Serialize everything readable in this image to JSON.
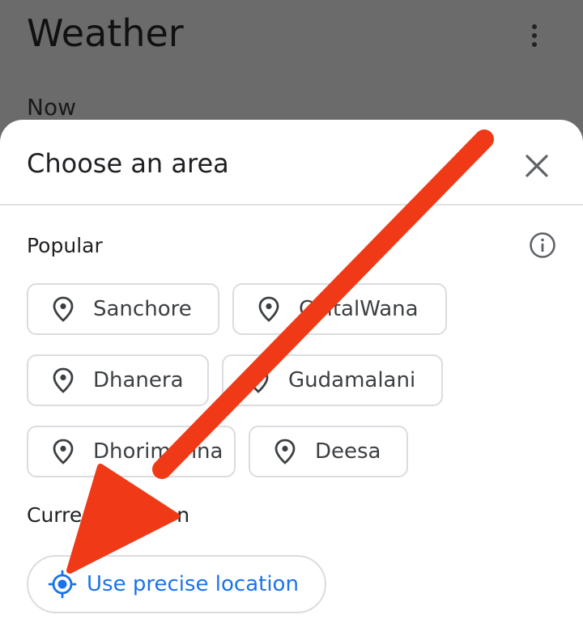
{
  "app": {
    "title": "Weather",
    "now_label": "Now",
    "menu_icon": "more-vert-icon"
  },
  "sheet": {
    "title": "Choose an area",
    "close_icon": "close-icon",
    "popular": {
      "label": "Popular",
      "info_icon": "info-icon",
      "chips": [
        {
          "label": "Sanchore",
          "icon": "location-pin-icon"
        },
        {
          "label": "ChitalWana",
          "icon": "location-pin-icon"
        },
        {
          "label": "Dhanera",
          "icon": "location-pin-icon"
        },
        {
          "label": "Gudamalani",
          "icon": "location-pin-icon"
        },
        {
          "label": "Dhorimanna",
          "icon": "location-pin-icon"
        },
        {
          "label": "Deesa",
          "icon": "location-pin-icon"
        }
      ]
    },
    "current": {
      "label": "Current location",
      "button_label": "Use precise location",
      "button_icon": "gps-target-icon"
    }
  },
  "overlay": {
    "icon": "red-arrow-annotation",
    "color": "#f03a17"
  },
  "colors": {
    "accent": "#1a73e8",
    "scrim": "#6b6b6b",
    "chip_border": "#dadce0"
  }
}
